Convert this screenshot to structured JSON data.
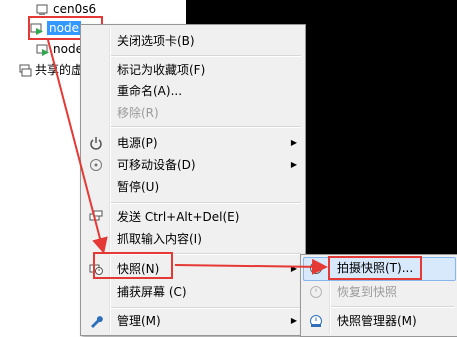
{
  "tree": {
    "items": [
      {
        "label": "cen0s6"
      },
      {
        "label": "node"
      },
      {
        "label": "node"
      },
      {
        "label": "共享的虚"
      }
    ]
  },
  "context_menu": {
    "items": [
      {
        "label": "关闭选项卡(B)"
      },
      {
        "label": "标记为收藏项(F)"
      },
      {
        "label": "重命名(A)..."
      },
      {
        "label": "移除(R)"
      },
      {
        "label": "电源(P)"
      },
      {
        "label": "可移动设备(D)"
      },
      {
        "label": "暂停(U)"
      },
      {
        "label": "发送 Ctrl+Alt+Del(E)"
      },
      {
        "label": "抓取输入内容(I)"
      },
      {
        "label": "快照(N)"
      },
      {
        "label": "捕获屏幕 (C)"
      },
      {
        "label": "管理(M)"
      }
    ]
  },
  "snapshot_submenu": {
    "items": [
      {
        "label": "拍摄快照(T)..."
      },
      {
        "label": "恢复到快照"
      },
      {
        "label": "快照管理器(M)"
      }
    ]
  },
  "colors": {
    "annotation": "#e53935",
    "selection": "#3399ff",
    "menu_bg": "#f0f0f0"
  }
}
